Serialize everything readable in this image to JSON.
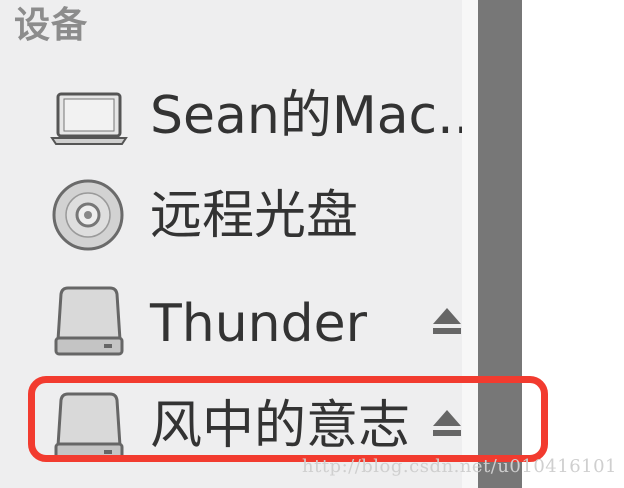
{
  "sidebar": {
    "section_title": "设备",
    "items": [
      {
        "label": "Sean的Mac...",
        "icon": "laptop-icon",
        "ejectable": false
      },
      {
        "label": "远程光盘",
        "icon": "optical-disc-icon",
        "ejectable": false
      },
      {
        "label": "Thunder",
        "icon": "external-drive-icon",
        "ejectable": true
      },
      {
        "label": "风中的意志",
        "icon": "external-drive-icon",
        "ejectable": true
      }
    ]
  },
  "highlight": {
    "color": "#f23b2f"
  },
  "watermark": "http://blog.csdn.net/u010416101",
  "colors": {
    "sidebar_bg": "#eeeeef",
    "scrollbar": "#777777",
    "header_text": "#8c8c8c",
    "label_text": "#333333"
  }
}
